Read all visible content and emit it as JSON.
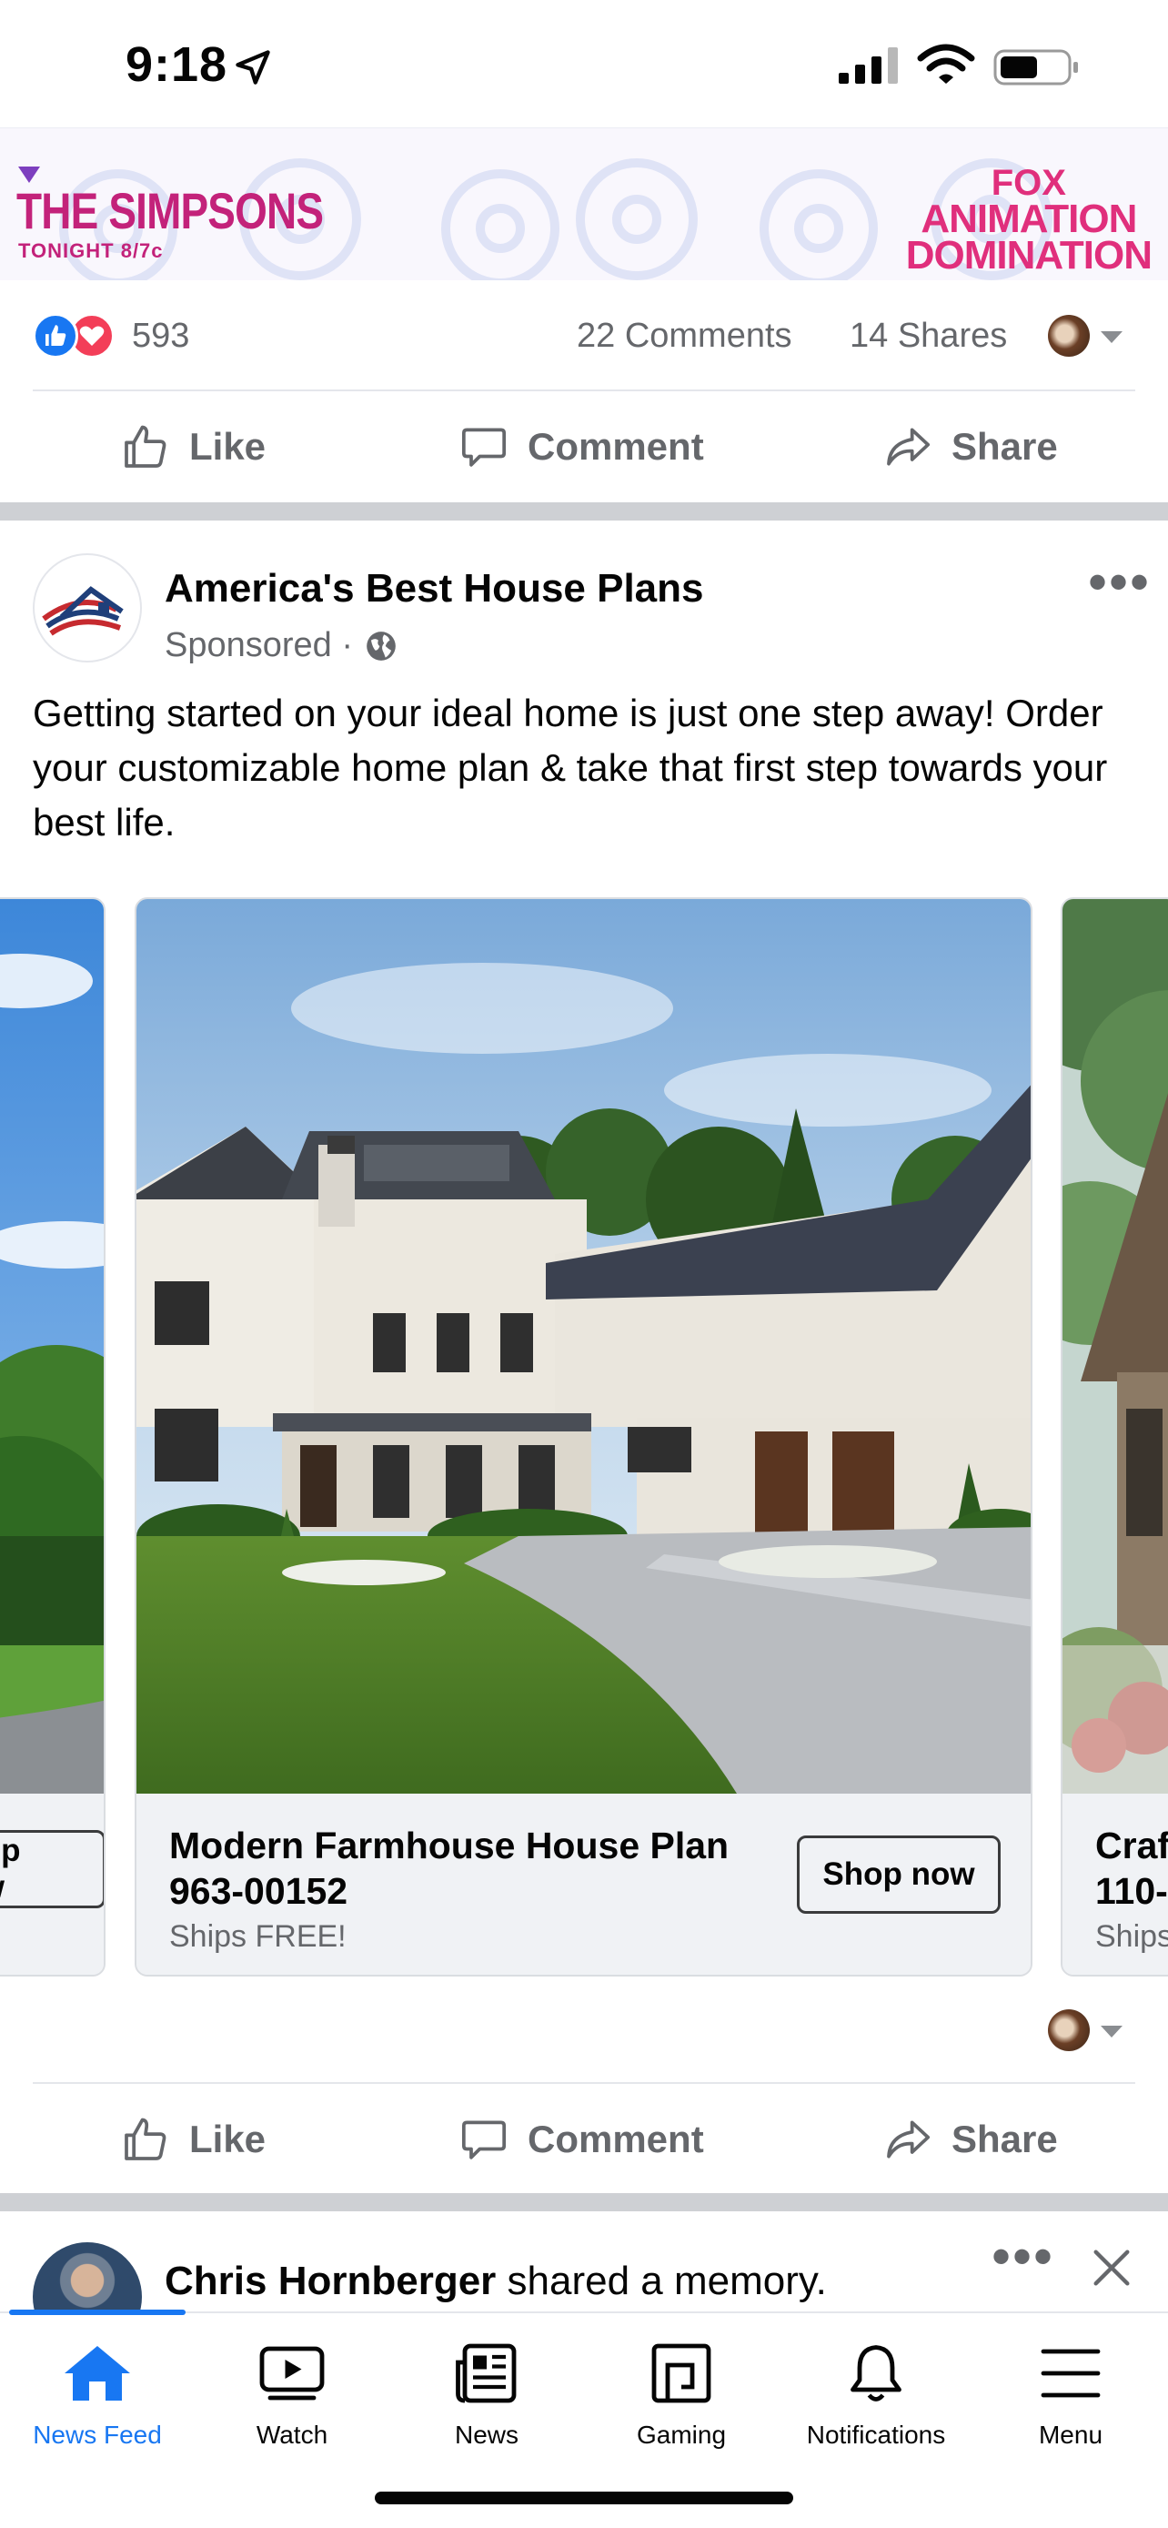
{
  "status_bar": {
    "time": "9:18"
  },
  "promo_banner": {
    "left_title": "THE SIMPSONS",
    "left_subtitle": "TONIGHT 8/7c",
    "right_line1": "FOX",
    "right_line2": "ANIMATION",
    "right_line3": "DOMINATION"
  },
  "post1": {
    "reaction_count": "593",
    "comments": "22 Comments",
    "shares": "14 Shares",
    "actions": {
      "like": "Like",
      "comment": "Comment",
      "share": "Share"
    }
  },
  "sponsored_post": {
    "page_name": "America's Best House Plans",
    "sponsored_label": "Sponsored ·",
    "body_text": "Getting started on your ideal home is just one step away! Order your customizable home plan & take that first step towards your best life.",
    "carousel": {
      "left_partial": {
        "button": "Shop now"
      },
      "main": {
        "title": "Modern Farmhouse House Plan 963-00152",
        "subtitle": "Ships FREE!",
        "button": "Shop now"
      },
      "right_partial": {
        "title_line1": "Craf",
        "title_line2": "110-",
        "subtitle": "Ships"
      }
    },
    "actions": {
      "like": "Like",
      "comment": "Comment",
      "share": "Share"
    }
  },
  "next_post": {
    "author": "Chris Hornberger",
    "action_text": " shared a memory."
  },
  "tab_bar": {
    "items": [
      {
        "label": "News Feed",
        "icon": "home-icon",
        "active": true
      },
      {
        "label": "Watch",
        "icon": "watch-icon",
        "active": false
      },
      {
        "label": "News",
        "icon": "news-icon",
        "active": false
      },
      {
        "label": "Gaming",
        "icon": "gaming-icon",
        "active": false
      },
      {
        "label": "Notifications",
        "icon": "bell-icon",
        "active": false
      },
      {
        "label": "Menu",
        "icon": "menu-icon",
        "active": false
      }
    ]
  },
  "colors": {
    "brand_blue": "#1877f2",
    "secondary_text": "#65676b",
    "love_red": "#f33e58",
    "promo_pink": "#e02f7c"
  }
}
